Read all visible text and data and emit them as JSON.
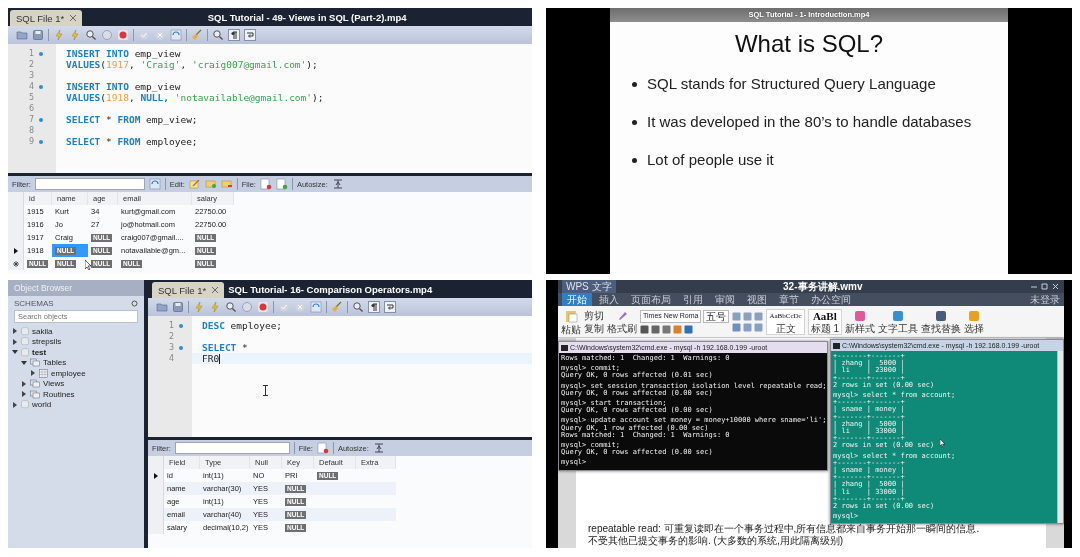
{
  "videos": [
    {
      "kind": "editor_results",
      "tab": "SQL File 1*",
      "title": "SQL Tutorial - 49- Views in SQL (Part-2).mp4",
      "code": [
        {
          "number": "1",
          "marked": true,
          "current": false,
          "tokens": [
            {
              "kind": "keyword",
              "text": "INSERT INTO"
            },
            {
              "kind": "plain",
              "text": " emp_view"
            }
          ]
        },
        {
          "number": "2",
          "marked": false,
          "current": false,
          "tokens": [
            {
              "kind": "keyword",
              "text": "VALUES"
            },
            {
              "kind": "plain",
              "text": "("
            },
            {
              "kind": "number",
              "text": "1917"
            },
            {
              "kind": "plain",
              "text": ", "
            },
            {
              "kind": "string",
              "text": "'Craig'"
            },
            {
              "kind": "plain",
              "text": ", "
            },
            {
              "kind": "string",
              "text": "'craig007@gmail.com'"
            },
            {
              "kind": "plain",
              "text": ");"
            }
          ]
        },
        {
          "number": "3",
          "marked": false,
          "current": false
        },
        {
          "number": "4",
          "marked": true,
          "current": false,
          "tokens": [
            {
              "kind": "keyword",
              "text": "INSERT INTO"
            },
            {
              "kind": "plain",
              "text": " emp_view"
            }
          ]
        },
        {
          "number": "5",
          "marked": false,
          "current": false,
          "tokens": [
            {
              "kind": "keyword",
              "text": "VALUES"
            },
            {
              "kind": "plain",
              "text": "("
            },
            {
              "kind": "number",
              "text": "1918"
            },
            {
              "kind": "plain",
              "text": ", "
            },
            {
              "kind": "keyword",
              "text": "NULL"
            },
            {
              "kind": "plain",
              "text": ", "
            },
            {
              "kind": "string",
              "text": "'notavailable@gmail.com'"
            },
            {
              "kind": "plain",
              "text": ");"
            }
          ]
        },
        {
          "number": "6",
          "marked": false,
          "current": false
        },
        {
          "number": "7",
          "marked": true,
          "current": false,
          "tokens": [
            {
              "kind": "keyword",
              "text": "SELECT"
            },
            {
              "kind": "plain",
              "text": " * "
            },
            {
              "kind": "keyword",
              "text": "FROM"
            },
            {
              "kind": "plain",
              "text": " emp_view;"
            }
          ]
        },
        {
          "number": "8",
          "marked": false,
          "current": false
        },
        {
          "number": "9",
          "marked": true,
          "current": false,
          "tokens": [
            {
              "kind": "keyword",
              "text": "SELECT"
            },
            {
              "kind": "plain",
              "text": " * "
            },
            {
              "kind": "keyword",
              "text": "FROM"
            },
            {
              "kind": "plain",
              "text": " employee;"
            }
          ]
        }
      ],
      "results": {
        "filter_label": "Filter:",
        "edit_label": "Edit:",
        "file_label": "File:",
        "autosize_label": "Autosize:",
        "columns": [
          "id",
          "name",
          "age",
          "email",
          "salary"
        ],
        "rows": [
          {
            "kind": "data",
            "current": false,
            "cells": [
              "1915",
              "Kurt",
              "34",
              "kurt@gmail.com",
              "22750.00"
            ]
          },
          {
            "kind": "data",
            "current": false,
            "cells": [
              "1916",
              "Jo",
              "27",
              "jo@hotmail.com",
              "22750.00"
            ]
          },
          {
            "kind": "data",
            "current": false,
            "cells": [
              "1917",
              "Craig",
              {
                "kind": "null",
                "text": "NULL",
                "selected": false
              },
              "craig007@gmail....",
              {
                "kind": "null",
                "text": "NULL",
                "selected": false
              }
            ]
          },
          {
            "kind": "data",
            "current": true,
            "cells": [
              "1918",
              {
                "kind": "null",
                "text": "NULL",
                "selected": true
              },
              {
                "kind": "null",
                "text": "NULL",
                "selected": false
              },
              "notavailable@gm...",
              {
                "kind": "null",
                "text": "NULL",
                "selected": false
              }
            ]
          },
          {
            "kind": "new",
            "current": false,
            "cells": [
              {
                "kind": "null",
                "text": "NULL",
                "selected": false
              },
              {
                "kind": "null",
                "text": "NULL",
                "selected": false
              },
              {
                "kind": "null",
                "text": "NULL",
                "selected": false
              },
              {
                "kind": "null",
                "text": "NULL",
                "selected": false
              },
              {
                "kind": "null",
                "text": "NULL",
                "selected": false
              }
            ]
          }
        ]
      }
    },
    {
      "kind": "slide",
      "title": "SQL Tutorial - 1- Introduction.mp4",
      "heading": "What is SQL?",
      "bullets": [
        "SQL stands for Structured Query Language",
        "It was developed in the 80’s to handle databases",
        "Lot of people use it"
      ]
    },
    {
      "kind": "browser_editor_results",
      "tab": "SQL File 1*",
      "title": "SQL Tutorial- 16- Comparison Operators.mp4",
      "sidebar": {
        "header": "Object Browser",
        "section": "SCHEMAS",
        "search_placeholder": "Search objects",
        "tree": [
          {
            "label": "sakila",
            "kind": "schema",
            "expanded": false,
            "active": false
          },
          {
            "label": "strepsils",
            "kind": "schema",
            "expanded": false,
            "active": false
          },
          {
            "label": "test",
            "kind": "schema",
            "expanded": true,
            "active": true,
            "children": [
              {
                "label": "Tables",
                "kind": "folder",
                "expanded": true,
                "active": false,
                "children": [
                  {
                    "label": "employee",
                    "kind": "table",
                    "expanded": false,
                    "active": false
                  }
                ]
              },
              {
                "label": "Views",
                "kind": "folder",
                "expanded": false,
                "active": false
              },
              {
                "label": "Routines",
                "kind": "folder",
                "expanded": false,
                "active": false
              }
            ]
          },
          {
            "label": "world",
            "kind": "schema",
            "expanded": false,
            "active": false
          }
        ]
      },
      "code": [
        {
          "number": "1",
          "marked": true,
          "current": false,
          "tokens": [
            {
              "kind": "keyword",
              "text": "DESC"
            },
            {
              "kind": "plain",
              "text": " employee;"
            }
          ]
        },
        {
          "number": "2",
          "marked": false,
          "current": false
        },
        {
          "number": "3",
          "marked": true,
          "current": false,
          "tokens": [
            {
              "kind": "keyword",
              "text": "SELECT"
            },
            {
              "kind": "plain",
              "text": " *"
            }
          ]
        },
        {
          "number": "4",
          "marked": false,
          "current": true,
          "tokens": [
            {
              "kind": "plain",
              "text": "FR0"
            }
          ]
        }
      ],
      "results": {
        "filter_label": "Filter:",
        "file_label": "File:",
        "autosize_label": "Autosize:",
        "columns": [
          "Field",
          "Type",
          "Null",
          "Key",
          "Default",
          "Extra"
        ],
        "rows": [
          {
            "kind": "data",
            "current": true,
            "cells": [
              "id",
              "int(11)",
              "NO",
              "PRI",
              {
                "kind": "null",
                "text": "NULL",
                "selected": false
              }
            ]
          },
          {
            "kind": "data",
            "current": false,
            "cells": [
              "name",
              "varchar(30)",
              "YES",
              {
                "kind": "null",
                "text": "NULL",
                "selected": false
              }
            ]
          },
          {
            "kind": "data",
            "current": false,
            "cells": [
              "age",
              "int(11)",
              "YES",
              {
                "kind": "null",
                "text": "NULL",
                "selected": false
              }
            ]
          },
          {
            "kind": "data",
            "current": false,
            "cells": [
              "email",
              "varchar(40)",
              "YES",
              {
                "kind": "null",
                "text": "NULL",
                "selected": false
              }
            ]
          },
          {
            "kind": "data",
            "current": false,
            "cells": [
              "salary",
              "decimal(10,2)",
              "YES",
              {
                "kind": "null",
                "text": "NULL",
                "selected": false
              }
            ]
          }
        ]
      }
    },
    {
      "kind": "wps_terminals",
      "app_badge": "WPS 文字",
      "title": "32-事务讲解.wmv",
      "account": "未登录",
      "menu_tabs": [
        {
          "label": "开始",
          "selected": true
        },
        {
          "label": "插入",
          "selected": false
        },
        {
          "label": "页面布局",
          "selected": false
        },
        {
          "label": "引用",
          "selected": false
        },
        {
          "label": "审阅",
          "selected": false
        },
        {
          "label": "视图",
          "selected": false
        },
        {
          "label": "章节",
          "selected": false
        },
        {
          "label": "办公空间",
          "selected": false
        }
      ],
      "ribbon": {
        "paste": "粘贴",
        "cut": "剪切",
        "copy": "复制",
        "format_painter": "格式刷",
        "font_name": "Times New Roma",
        "font_size": "五号",
        "styles": [
          {
            "sample": "AaBbCcDc",
            "label": "正文"
          },
          {
            "sample": "AaBl",
            "label": "标题 1"
          }
        ],
        "tools": [
          "新样式",
          "文字工具",
          "查找替换",
          "选择"
        ]
      },
      "terminals": [
        {
          "kind": "dark",
          "title": "C:\\Windows\\system32\\cmd.exe - mysql  -h 192.168.0.199 -uroot",
          "blocks": [
            [
              "Rows matched: 1  Changed: 1  Warnings: 0"
            ],
            [
              "mysql> commit;",
              "Query OK, 0 rows affected (0.01 sec)"
            ],
            [
              "mysql> set session transaction isolation level repeatable read;",
              "Query OK, 0 rows affected (0.00 sec)"
            ],
            [
              "mysql> start transaction;",
              "Query OK, 0 rows affected (0.00 sec)"
            ],
            [
              "mysql> update account set money = money+10000 where sname='li';",
              "Query OK, 1 row affected (0.00 sec)",
              "Rows matched: 1  Changed: 1  Warnings: 0"
            ],
            [
              "mysql> commit;",
              "Query OK, 0 rows affected (0.00 sec)"
            ],
            [
              "mysql>"
            ]
          ]
        },
        {
          "kind": "teal",
          "title": "C:\\Windows\\system32\\cmd.exe - mysql  -h 192.168.0.199 -uroot",
          "blocks": [
            [
              "+-------+-------+",
              "| zhang |  5000 |",
              "| li    | 23000 |",
              "+-------+-------+",
              "2 rows in set (0.00 sec)"
            ],
            [
              "mysql> select * from account;",
              "+-------+-------+",
              "| sname | money |",
              "+-------+-------+",
              "| zhang |  5000 |",
              "| li    | 33000 |",
              "+-------+-------+",
              "2 rows in set (0.00 sec)"
            ],
            [
              "mysql> select * from account;",
              "+-------+-------+",
              "| sname | money |",
              "+-------+-------+",
              "| zhang |  5000 |",
              "| li    | 33000 |",
              "+-------+-------+",
              "2 rows in set (0.00 sec)"
            ],
            [
              "mysql>"
            ]
          ]
        }
      ],
      "doc_lines": [
        "repeatable read: 可重复读即在一个事务过程中,所有信息都来自事务开始那一瞬间的信息.",
        "不受其他已提交事务的影响. (大多数的系统,用此隔离级别)"
      ]
    }
  ]
}
